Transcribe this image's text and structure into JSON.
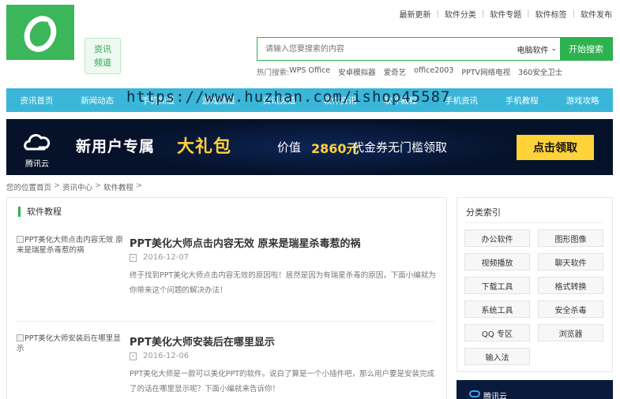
{
  "top_links": [
    "最新更新",
    "软件分类",
    "软件专题",
    "软件标签",
    "软件发布"
  ],
  "top_separator": "|",
  "channel": {
    "line1": "资讯",
    "line2": "频道"
  },
  "search": {
    "placeholder": "请输入您要搜索的内容",
    "category": "电脑软件",
    "chevron": "⌄",
    "button": "开始搜索"
  },
  "hot": {
    "label": "热门搜索:",
    "items": [
      "WPS Office",
      "安卓模拟器",
      "爱奇艺",
      "office2003",
      "PPTV网络电视",
      "360安全卫士"
    ]
  },
  "nav": [
    "资讯首页",
    "新闻动态",
    "手机频道",
    "游戏频道",
    "资讯频道",
    "软件资讯",
    "软件教程",
    "手机资讯",
    "手机教程",
    "游戏攻略"
  ],
  "watermark": "https://www.huzhan.com/ishop45587",
  "banner": {
    "brand": "腾讯云",
    "t1": "新用户专属",
    "t2": "大礼包",
    "t3": "价值",
    "t4": "2860元",
    "t5": "代金券无门槛领取",
    "cta": "点击领取"
  },
  "breadcrumb": {
    "prefix": "您的位置",
    "items": [
      "首页",
      "资讯中心",
      "软件教程"
    ],
    "separator": ">"
  },
  "section_title": "软件教程",
  "articles": [
    {
      "thumb_alt": "PPT美化大师点击内容无效 原来是瑞星杀毒惹的祸",
      "title": "PPT美化大师点击内容无效 原来是瑞星杀毒惹的祸",
      "date": "2016-12-07",
      "desc": "终于找到PPT美化大师点击内容无效的原因啦！居然是因为有瑞星杀毒的原因，下面小编就为你带来这个问题的解决办法！"
    },
    {
      "thumb_alt": "PPT美化大师安装后在哪里显示",
      "title": "PPT美化大师安装后在哪里显示",
      "date": "2016-12-06",
      "desc": "PPT美化大师是一款可以美化PPT的软件。说白了算是一个小插件吧，那么用户要是安装完成了的话在哪里显示呢？下面小编就来告诉你！"
    }
  ],
  "sidebar": {
    "title": "分类索引",
    "categories": [
      "办公软件",
      "图形图像",
      "视频播放",
      "聊天软件",
      "下载工具",
      "格式转换",
      "系统工具",
      "安全杀毒",
      "QQ 专区",
      "浏览器",
      "输入法"
    ]
  },
  "side_ad": {
    "text": "腾讯云"
  },
  "colors": {
    "brand_green": "#3cb65a",
    "nav_blue": "#3ab6d8",
    "banner_bg": "#06122a",
    "banner_yellow": "#ffd23a"
  }
}
